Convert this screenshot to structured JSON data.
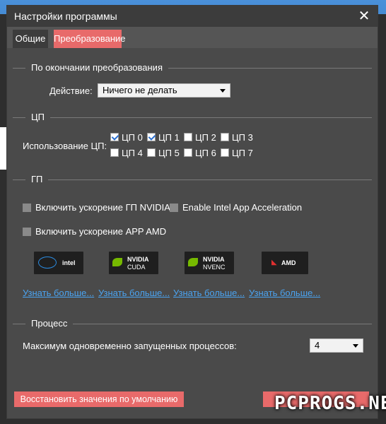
{
  "window": {
    "title": "Настройки программы"
  },
  "tabs": [
    {
      "label": "Общие"
    },
    {
      "label": "Преобразование"
    }
  ],
  "after_conversion": {
    "section_label": "По окончании преобразования",
    "action_label": "Действие:",
    "action_value": "Ничего не делать"
  },
  "cpu": {
    "section_label": "ЦП",
    "usage_label": "Использование ЦП:",
    "cores": [
      {
        "label": "ЦП 0",
        "checked": true
      },
      {
        "label": "ЦП 1",
        "checked": true
      },
      {
        "label": "ЦП 2",
        "checked": false
      },
      {
        "label": "ЦП 3",
        "checked": false
      },
      {
        "label": "ЦП 4",
        "checked": false
      },
      {
        "label": "ЦП 5",
        "checked": false
      },
      {
        "label": "ЦП 6",
        "checked": false
      },
      {
        "label": "ЦП 7",
        "checked": false
      }
    ]
  },
  "gpu": {
    "section_label": "ГП",
    "nvidia_accel": "Включить ускорение ГП NVIDIA",
    "intel_accel": "Enable Intel App Acceleration",
    "amd_accel": "Включить ускорение APP AMD",
    "logos": [
      {
        "icon": "intel-logo-icon",
        "text1": "intel",
        "text2": ""
      },
      {
        "icon": "nvidia-logo-icon",
        "text1": "NVIDIA",
        "text2": "CUDA"
      },
      {
        "icon": "nvidia-logo-icon",
        "text1": "NVIDIA",
        "text2": "NVENC"
      },
      {
        "icon": "amd-logo-icon",
        "text1": "AMD",
        "text2": ""
      }
    ],
    "learn_more": [
      "Узнать больше...",
      "Узнать больше...",
      "Узнать больше...",
      "Узнать больше..."
    ]
  },
  "process": {
    "section_label": "Процесс",
    "max_label": "Максимум одновременно запущенных процессов:",
    "max_value": "4"
  },
  "buttons": {
    "restore_defaults": "Восстановить значения по умолчанию"
  },
  "watermark": "PCPROGS.NET",
  "colors": {
    "accent": "#e86a6a",
    "link": "#4aa3f0",
    "panel": "#4a4a4a",
    "titlebar": "#3c3c3c"
  }
}
